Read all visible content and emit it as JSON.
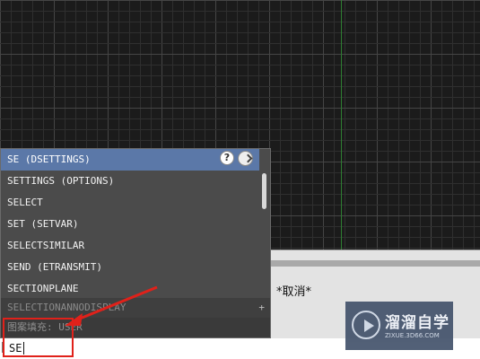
{
  "autocomplete": {
    "items": [
      {
        "label": "SE (DSETTINGS)",
        "selected": true
      },
      {
        "label": "SETTINGS (OPTIONS)",
        "selected": false
      },
      {
        "label": "SELECT",
        "selected": false
      },
      {
        "label": "SET (SETVAR)",
        "selected": false
      },
      {
        "label": "SELECTSIMILAR",
        "selected": false
      },
      {
        "label": "SEND (ETRANSMIT)",
        "selected": false
      },
      {
        "label": "SECTIONPLANE",
        "selected": false
      }
    ],
    "more_item": "SELECTIONANNODISPLAY",
    "more_plus": "+",
    "hint": "图案填充: USER",
    "help_label": "?",
    "help_icon": "question-circle-icon",
    "web_icon": "web-search-icon"
  },
  "command": {
    "history_text": "*取消*",
    "input_value": "SE"
  },
  "watermark": {
    "title": "溜溜自学",
    "subtitle": "ZIXUE.3D66.COM"
  },
  "colors": {
    "canvas_bg": "#1b1b1b",
    "grid_minor": "#2f2f2f",
    "grid_major": "#454545",
    "y_axis": "#2e7d32",
    "selected_row": "#5b78a8",
    "annotation": "#e0211a"
  }
}
